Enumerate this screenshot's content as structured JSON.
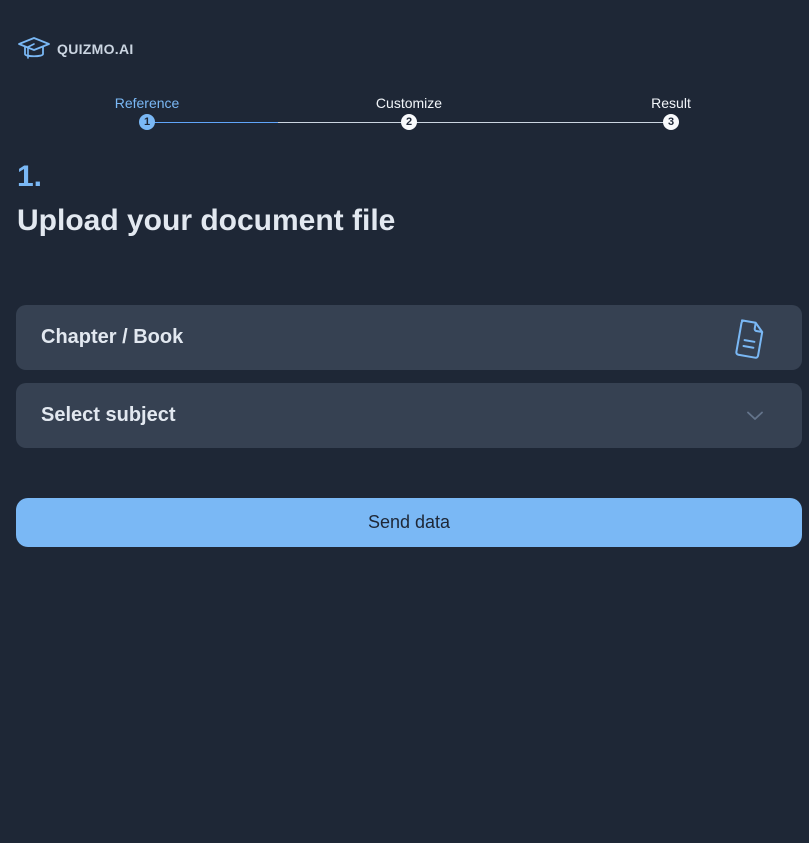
{
  "header": {
    "logo_text": "QUIZMO.AI",
    "logo_icon": "graduation-cap-icon"
  },
  "stepper": {
    "current_step": 1,
    "steps": [
      {
        "label": "Reference",
        "number": "1"
      },
      {
        "label": "Customize",
        "number": "2"
      },
      {
        "label": "Result",
        "number": "3"
      }
    ]
  },
  "main": {
    "step_number": "1.",
    "title": "Upload your document file",
    "upload_field": {
      "label": "Chapter / Book",
      "icon": "document-icon"
    },
    "subject_select": {
      "placeholder": "Select subject",
      "icon": "chevron-down-icon"
    },
    "submit_label": "Send data"
  },
  "colors": {
    "background": "#1e2736",
    "field_background": "#364152",
    "accent": "#7ab8f5",
    "text": "#e2e8f0"
  }
}
